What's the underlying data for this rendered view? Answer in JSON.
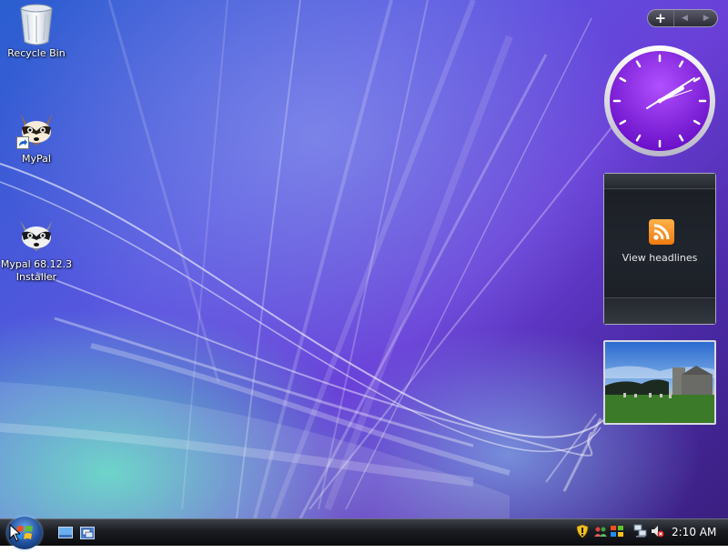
{
  "desktop_icons": [
    {
      "label": "Recycle Bin",
      "icon": "recycle-bin-icon"
    },
    {
      "label": "MyPal",
      "icon": "mypal-shortcut-icon"
    },
    {
      "label_line1": "Mypal 68.12.3",
      "label_line2": "Installer",
      "icon": "mypal-installer-icon"
    }
  ],
  "gadgets": {
    "add_label": "+",
    "prev_label": "◀",
    "next_label": "▶",
    "feed_text": "View headlines"
  },
  "taskbar": {
    "time": "2:10 AM"
  },
  "colors": {
    "clock_face": "#8a2be2",
    "rss_orange": "#f5901e",
    "taskbar_bg": "#1a1c22"
  }
}
